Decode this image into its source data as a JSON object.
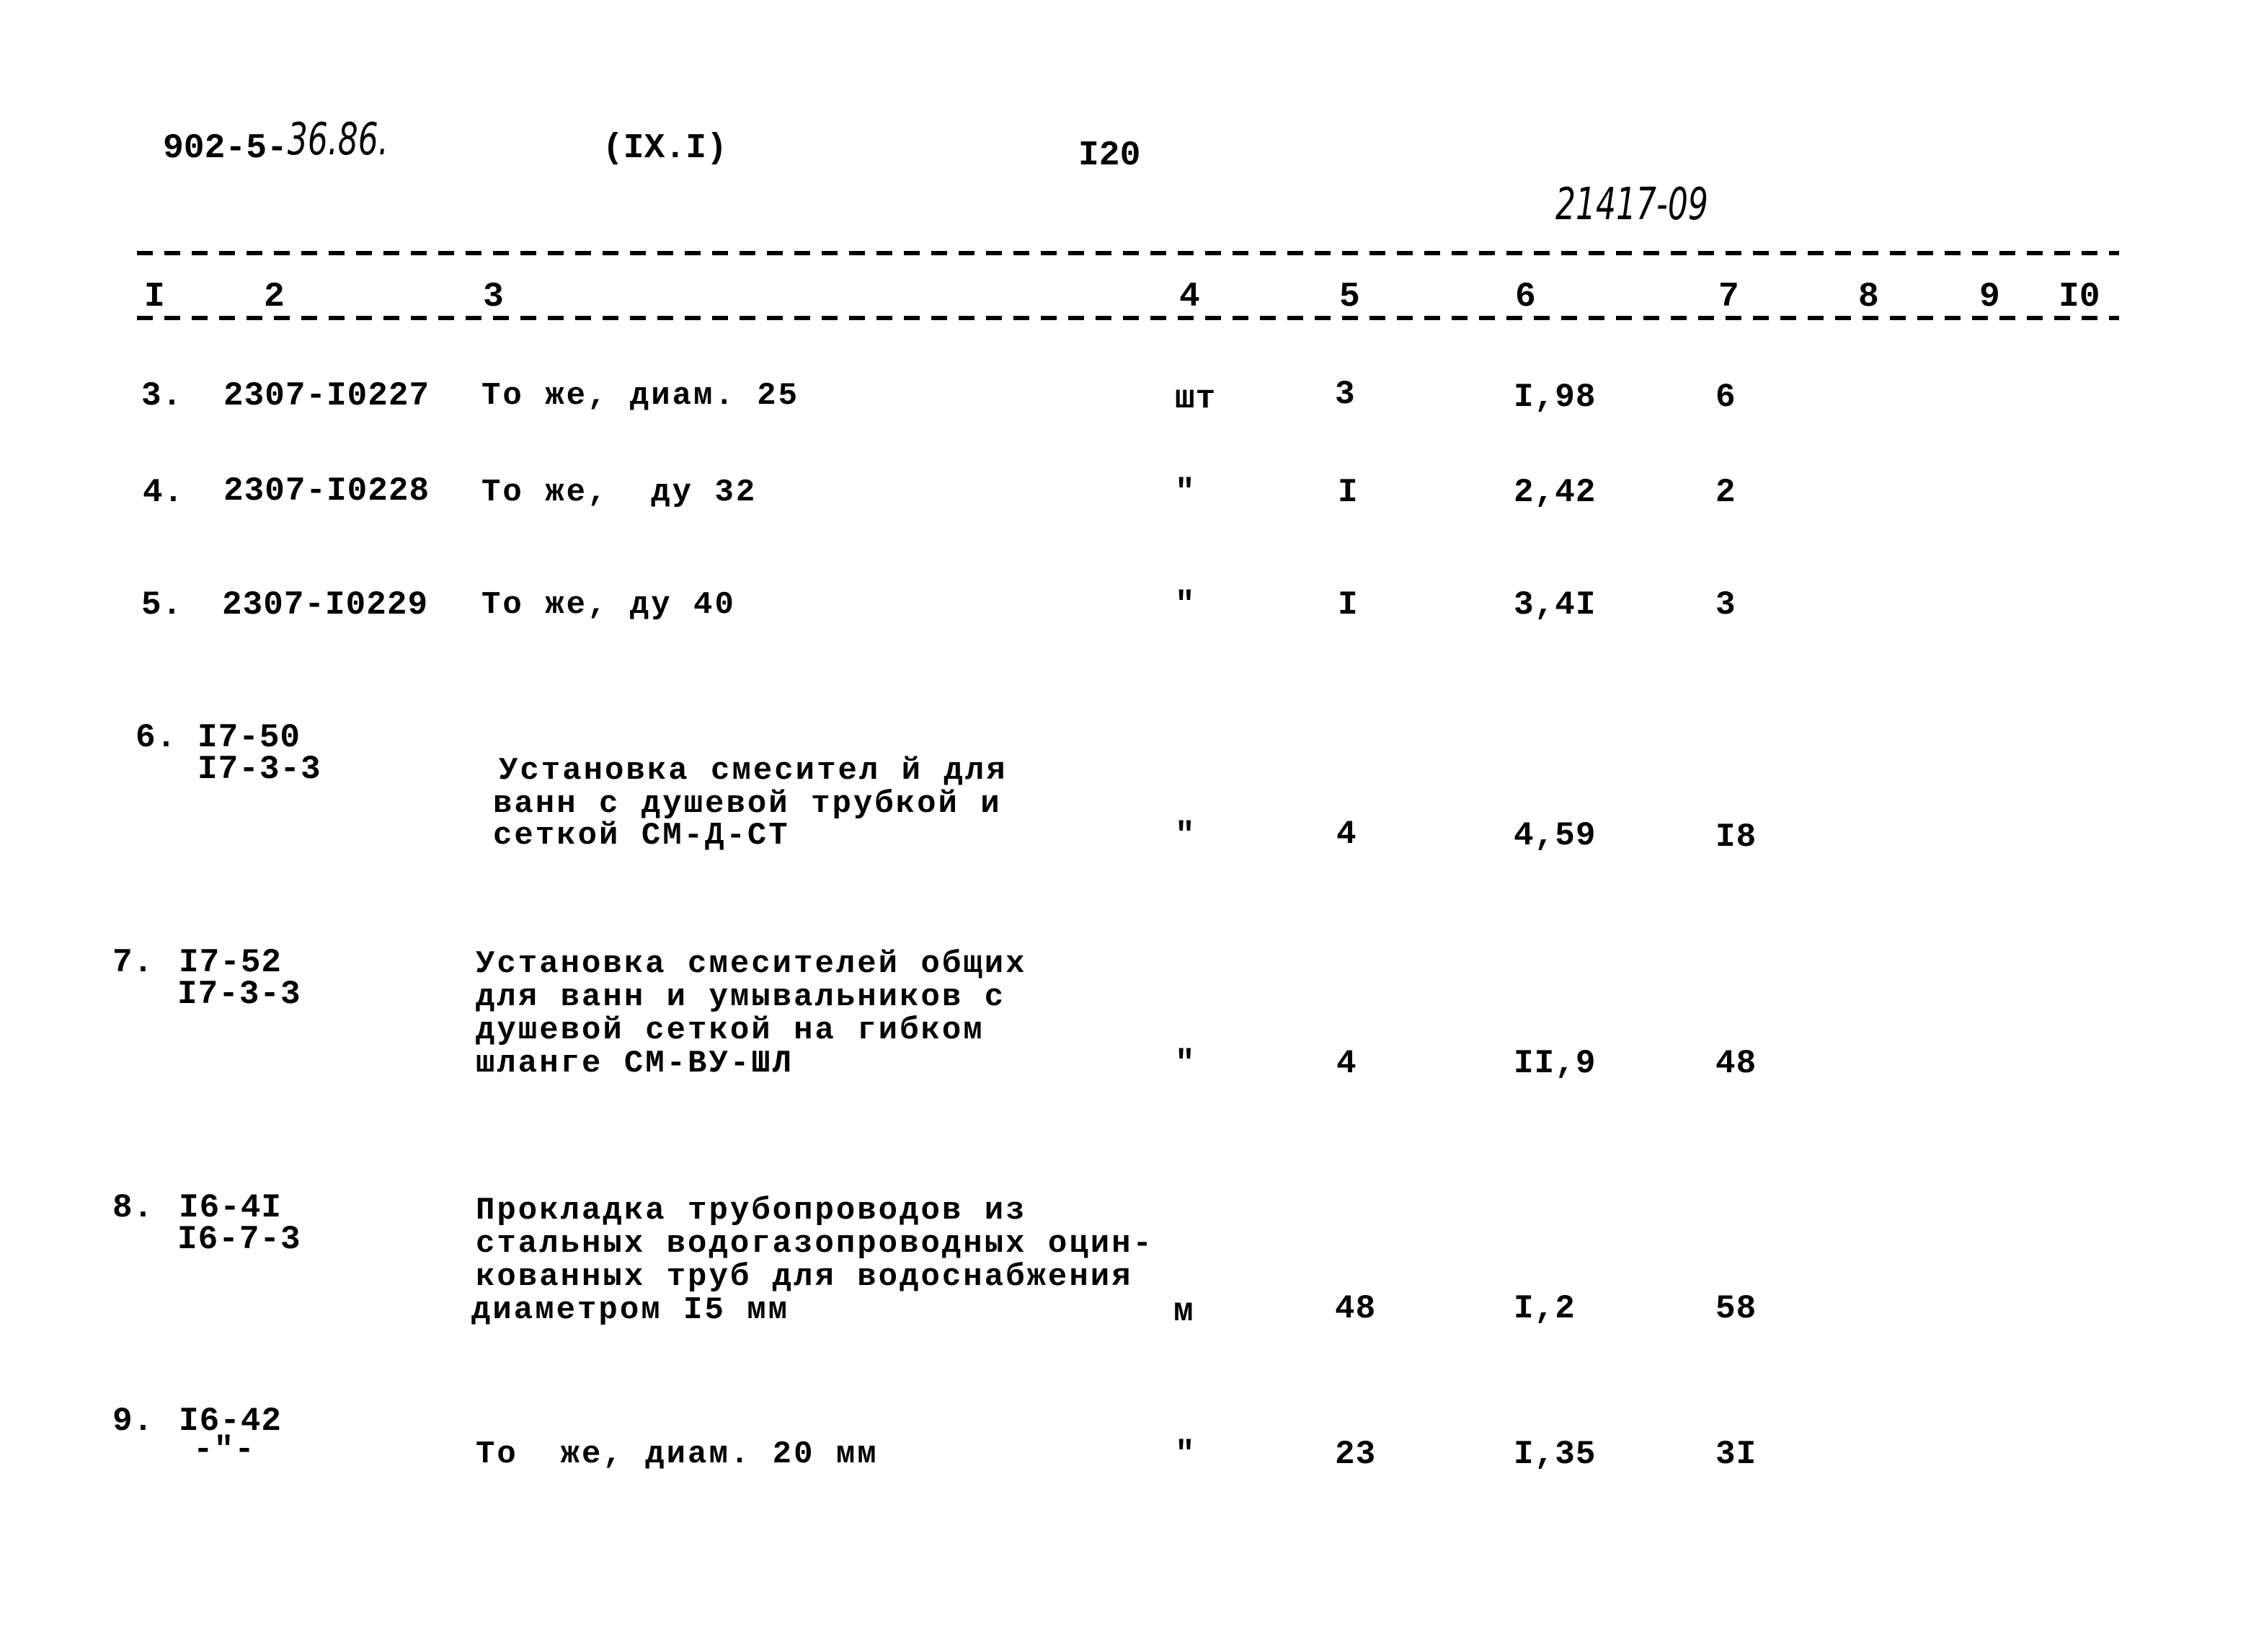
{
  "header": {
    "doc_code_printed": "902-5-",
    "doc_code_handwritten": "36.86.",
    "section": "(IX.I)",
    "page_number": "I20",
    "stamp_handwritten": "21417-09"
  },
  "columns": [
    "I",
    "2",
    "3",
    "4",
    "5",
    "6",
    "7",
    "8",
    "9",
    "I0"
  ],
  "rows": [
    {
      "num": "3.",
      "code": [
        "2307-I0227"
      ],
      "desc": [
        "То же, диам. 25"
      ],
      "unit": "шт",
      "qty": "3",
      "price": "I,98",
      "total": "6"
    },
    {
      "num": "4.",
      "code": [
        "2307-I0228"
      ],
      "desc": [
        "То же,  ду 32"
      ],
      "unit": "\"",
      "qty": "I",
      "price": "2,42",
      "total": "2"
    },
    {
      "num": "5.",
      "code": [
        "2307-I0229"
      ],
      "desc": [
        "То же, ду 40"
      ],
      "unit": "\"",
      "qty": "I",
      "price": "3,4I",
      "total": "3"
    },
    {
      "num": "6.",
      "code": [
        "I7-50",
        "I7-3-3"
      ],
      "desc": [
        "Установка смесител й для",
        "ванн с душевой трубкой и",
        "сеткой СМ-Д-СТ"
      ],
      "unit": "\"",
      "qty": "4",
      "price": "4,59",
      "total": "I8"
    },
    {
      "num": "7.",
      "code": [
        "I7-52",
        "I7-3-3"
      ],
      "desc": [
        "Установка смесителей общих",
        "для ванн и умывальников с",
        "душевой сеткой на гибком",
        "шланге СМ-ВУ-ШЛ"
      ],
      "unit": "\"",
      "qty": "4",
      "price": "II,9",
      "total": "48"
    },
    {
      "num": "8.",
      "code": [
        "I6-4I",
        "I6-7-3"
      ],
      "desc": [
        "Прокладка трубопроводов из",
        "стальных водогазопроводных оцин-",
        "кованных труб для водоснабжения",
        "диаметром I5 мм"
      ],
      "unit": "м",
      "qty": "48",
      "price": "I,2",
      "total": "58"
    },
    {
      "num": "9.",
      "code": [
        "I6-42",
        "-\"-"
      ],
      "desc": [
        "То  же, диам. 20 мм"
      ],
      "unit": "\"",
      "qty": "23",
      "price": "I,35",
      "total": "3I"
    }
  ]
}
